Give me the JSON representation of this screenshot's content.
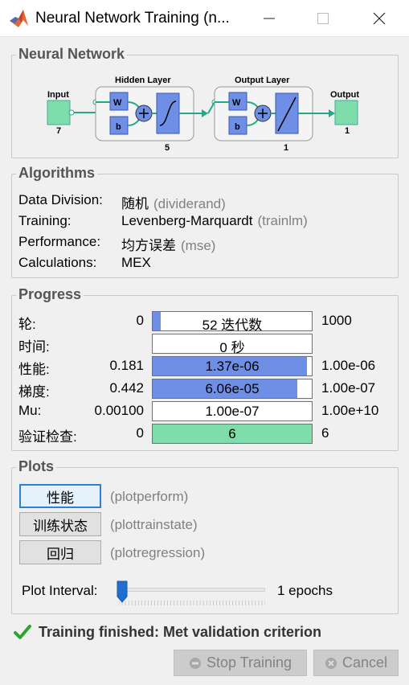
{
  "window": {
    "title": "Neural Network Training (n...",
    "minimize_symbol": "—",
    "maximize_symbol": "☐",
    "close_symbol": "✕"
  },
  "network": {
    "section_title": "Neural Network",
    "input_label": "Input",
    "input_size": "7",
    "hidden_label": "Hidden Layer",
    "hidden_size": "5",
    "output_layer_label": "Output Layer",
    "output_layer_size": "1",
    "output_label": "Output",
    "output_size": "1",
    "weight_symbol": "W",
    "bias_symbol": "b"
  },
  "algorithms": {
    "section_title": "Algorithms",
    "rows": [
      {
        "key": "Data Division:",
        "value": "随机",
        "fn": "(dividerand)"
      },
      {
        "key": "Training:",
        "value": "Levenberg-Marquardt",
        "fn": "(trainlm)"
      },
      {
        "key": "Performance:",
        "value": "均方误差",
        "fn": "(mse)"
      },
      {
        "key": "Calculations:",
        "value": "MEX",
        "fn": ""
      }
    ]
  },
  "progress": {
    "section_title": "Progress",
    "rows": [
      {
        "label": "轮:",
        "start": "0",
        "bar_text": "52 迭代数",
        "fill": 0.052,
        "fill_color": "#6f8fe6",
        "end": "1000"
      },
      {
        "label": "时间:",
        "start": "",
        "bar_text": "0 秒",
        "fill": 0,
        "fill_color": "#6f8fe6",
        "end": ""
      },
      {
        "label": "性能:",
        "start": "0.181",
        "bar_text": "1.37e-06",
        "fill": 0.97,
        "fill_color": "#6f8fe6",
        "end": "1.00e-06"
      },
      {
        "label": "梯度:",
        "start": "0.442",
        "bar_text": "6.06e-05",
        "fill": 0.91,
        "fill_color": "#6f8fe6",
        "end": "1.00e-07"
      },
      {
        "label": "Mu:",
        "start": "0.00100",
        "bar_text": "1.00e-07",
        "fill": 0,
        "fill_color": "#6f8fe6",
        "end": "1.00e+10"
      },
      {
        "label": "验证检查:",
        "start": "0",
        "bar_text": "6",
        "fill": 1.0,
        "fill_color": "#7fdcab",
        "end": "6"
      }
    ]
  },
  "plots": {
    "section_title": "Plots",
    "buttons": [
      {
        "label": "性能",
        "fn": "(plotperform)"
      },
      {
        "label": "训练状态",
        "fn": "(plottrainstate)"
      },
      {
        "label": "回归",
        "fn": "(plotregression)"
      }
    ],
    "interval_label": "Plot Interval:",
    "interval_value": "1 epochs"
  },
  "status": {
    "message": "Training finished: Met validation criterion"
  },
  "buttons": {
    "stop": "Stop Training",
    "cancel": "Cancel"
  },
  "colors": {
    "accent_blue": "#6f8fe6",
    "validation_green": "#7fdcab",
    "success_green": "#2da52d"
  }
}
